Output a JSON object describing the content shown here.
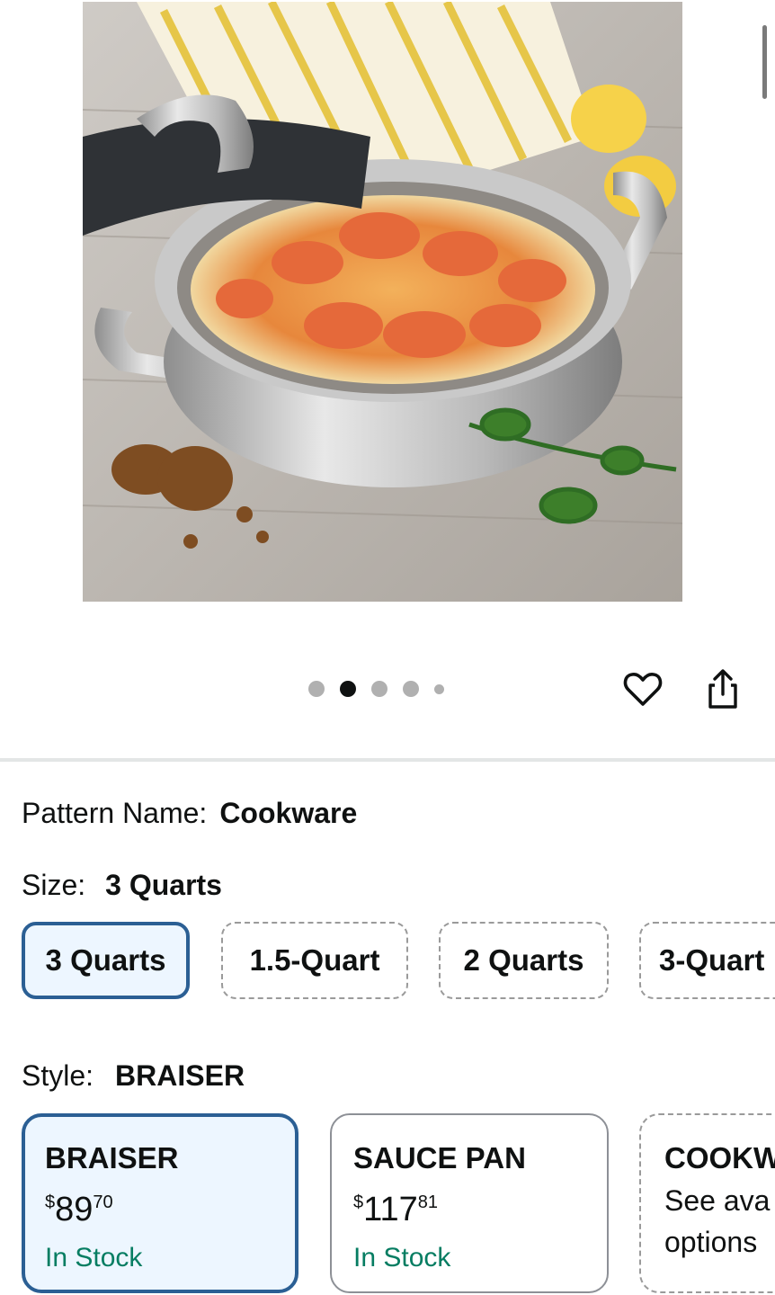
{
  "gallery": {
    "image_alt": "Stainless steel braiser with lid, filled with shrimp linguine",
    "dot_count": 5,
    "active_index": 1
  },
  "actions": {
    "favorite_icon": "heart-icon",
    "share_icon": "share-icon"
  },
  "pattern": {
    "label": "Pattern Name:",
    "value": "Cookware"
  },
  "size": {
    "label": "Size:",
    "value": "3 Quarts",
    "options": [
      "3 Quarts",
      "1.5-Quart",
      "2 Quarts",
      "3-Quart"
    ],
    "selected_index": 0
  },
  "style": {
    "label": "Style:",
    "value": "BRAISER",
    "options": [
      {
        "name": "BRAISER",
        "price_symbol": "$",
        "price_whole": "89",
        "price_fraction": "70",
        "stock": "In Stock"
      },
      {
        "name": "SAUCE PAN",
        "price_symbol": "$",
        "price_whole": "117",
        "price_fraction": "81",
        "stock": "In Stock"
      },
      {
        "name": "COOKW",
        "availability_line1": "See ava",
        "availability_line2": "options"
      }
    ],
    "selected_index": 0
  },
  "colors": {
    "accent": "#2b5f94",
    "stock": "#067d62",
    "selected_bg": "#edf6ff"
  }
}
